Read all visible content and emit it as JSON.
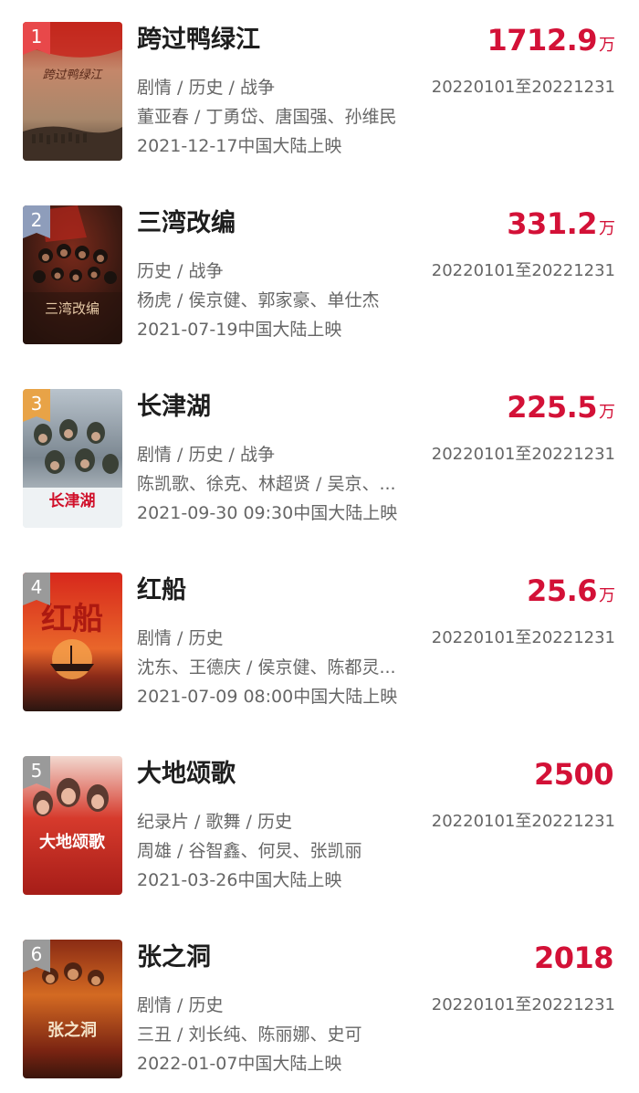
{
  "movies": [
    {
      "rank": "1",
      "title": "跨过鸭绿江",
      "box_value": "1712.9",
      "box_unit": "万",
      "genres": "剧情 / 历史 / 战争",
      "period": "20220101至20221231",
      "cast": "董亚春 / 丁勇岱、唐国强、孙维民",
      "release": "2021-12-17中国大陆上映",
      "poster_title": "跨过鸭绿江",
      "badge_color": "#e8484a"
    },
    {
      "rank": "2",
      "title": "三湾改编",
      "box_value": "331.2",
      "box_unit": "万",
      "genres": "历史 / 战争",
      "period": "20220101至20221231",
      "cast": "杨虎 / 侯京健、郭家豪、单仕杰",
      "release": "2021-07-19中国大陆上映",
      "poster_title": "三湾改编",
      "badge_color": "#8e9dbb"
    },
    {
      "rank": "3",
      "title": "长津湖",
      "box_value": "225.5",
      "box_unit": "万",
      "genres": "剧情 / 历史 / 战争",
      "period": "20220101至20221231",
      "cast": "陈凯歌、徐克、林超贤 / 吴京、...",
      "release": "2021-09-30 09:30中国大陆上映",
      "poster_title": "长津湖",
      "badge_color": "#e8a347"
    },
    {
      "rank": "4",
      "title": "红船",
      "box_value": "25.6",
      "box_unit": "万",
      "genres": "剧情 / 历史",
      "period": "20220101至20221231",
      "cast": "沈东、王德庆 / 侯京健、陈都灵...",
      "release": "2021-07-09 08:00中国大陆上映",
      "poster_title": "红船",
      "badge_color": "#9a9a9a"
    },
    {
      "rank": "5",
      "title": "大地颂歌",
      "box_value": "2500",
      "box_unit": "",
      "genres": "纪录片 / 歌舞 / 历史",
      "period": "20220101至20221231",
      "cast": "周雄 / 谷智鑫、何炅、张凯丽",
      "release": "2021-03-26中国大陆上映",
      "poster_title": "大地颂歌",
      "badge_color": "#9a9a9a"
    },
    {
      "rank": "6",
      "title": "张之洞",
      "box_value": "2018",
      "box_unit": "",
      "genres": "剧情 / 历史",
      "period": "20220101至20221231",
      "cast": "三丑 / 刘长纯、陈丽娜、史可",
      "release": "2022-01-07中国大陆上映",
      "poster_title": "张之洞",
      "badge_color": "#9a9a9a"
    }
  ]
}
